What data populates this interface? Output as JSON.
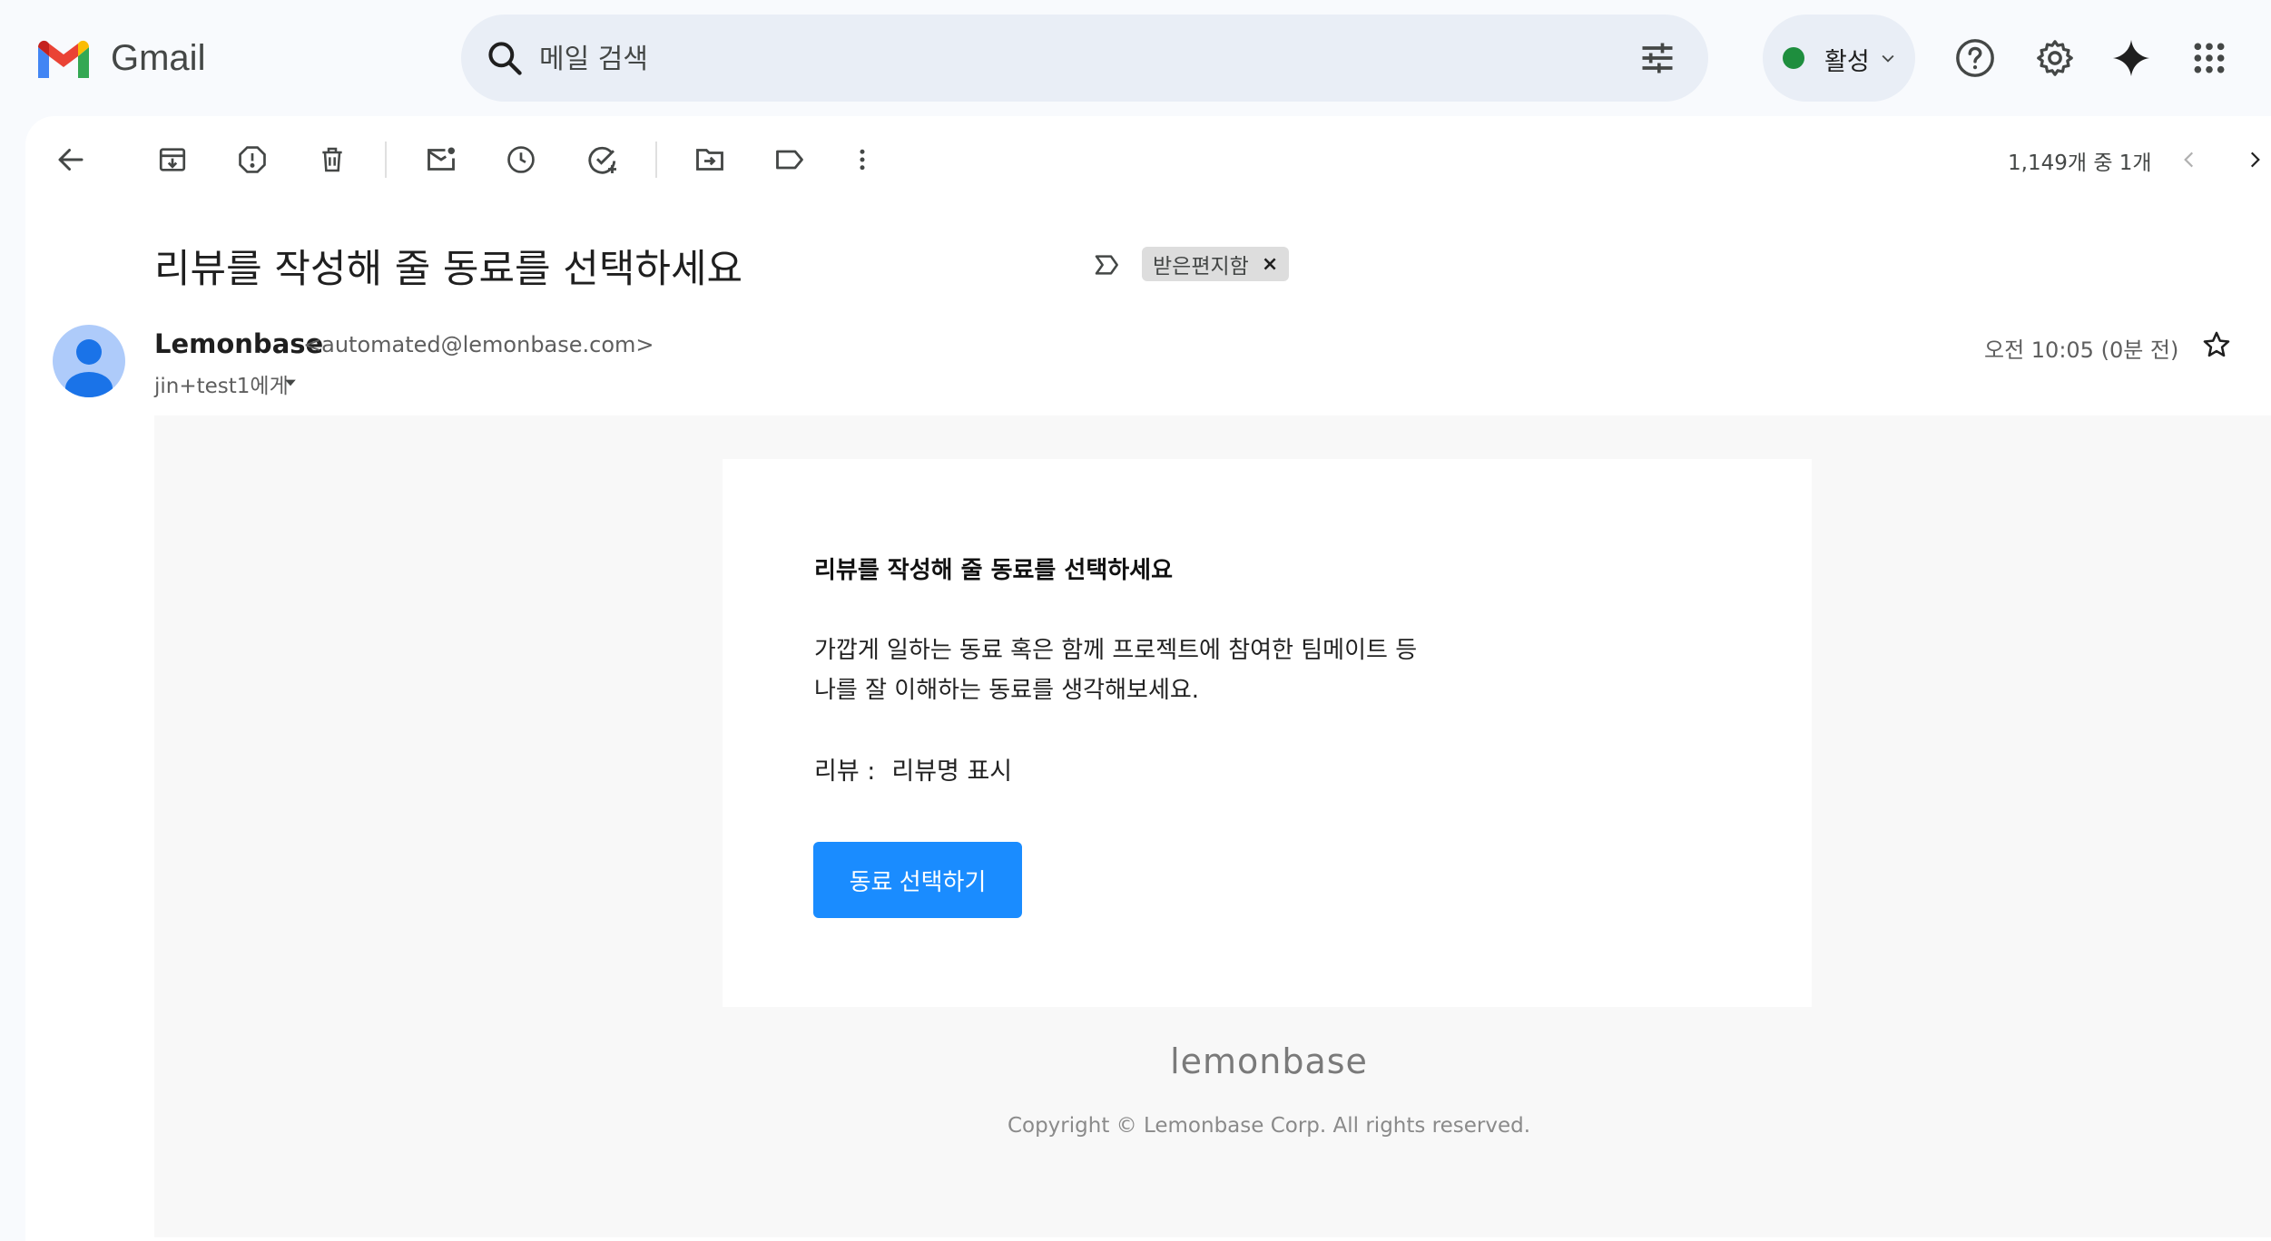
{
  "app": {
    "name": "Gmail"
  },
  "colors": {
    "accent_blue": "#1a8cff",
    "status_green": "#1e8e3e",
    "avatar_bg": "#aecbfa",
    "avatar_fg": "#1a73e8"
  },
  "search": {
    "placeholder": "메일 검색"
  },
  "status": {
    "label": "활성"
  },
  "toolbar": {
    "icons": [
      "back-arrow-icon",
      "archive-icon",
      "report-spam-icon",
      "delete-icon",
      "mark-unread-icon",
      "snooze-icon",
      "add-task-icon",
      "move-to-icon",
      "label-icon",
      "more-vert-icon"
    ]
  },
  "pager": {
    "count": "1,149개 중 1개"
  },
  "message": {
    "subject": "리뷰를 작성해 줄 동료를 선택하세요",
    "label_chip": "받은편지함",
    "sender_name": "Lemonbase",
    "sender_email": "<automated@lemonbase.com>",
    "recipient": "jin+test1에게",
    "timestamp": "오전 10:05 (0분 전)"
  },
  "email": {
    "heading": "리뷰를 작성해 줄 동료를 선택하세요",
    "line1": "가깝게 일하는 동료 혹은 함께 프로젝트에 참여한 팀메이트 등",
    "line2": "나를 잘 이해하는 동료를 생각해보세요.",
    "review_label": "리뷰 :",
    "review_name": "리뷰명 표시",
    "cta_label": "동료 선택하기",
    "footer_logo": "lemonbase",
    "copyright": "Copyright © Lemonbase Corp. All rights reserved."
  }
}
